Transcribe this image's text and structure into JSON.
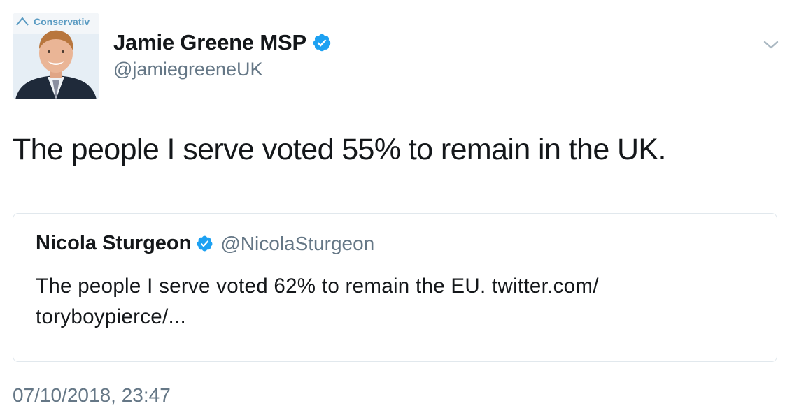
{
  "tweet": {
    "author": {
      "display_name": "Jamie Greene MSP",
      "handle": "@jamiegreeneUK",
      "verified": true,
      "avatar_backdrop_text": "Conservativ"
    },
    "text": "The people I serve voted 55% to remain in the UK.",
    "menu_icon": "chevron-down-icon",
    "quoted_tweet": {
      "display_name": "Nicola Sturgeon",
      "handle": "@NicolaSturgeon",
      "verified": true,
      "text_line1": "The people I serve voted 62% to remain the EU. twitter.com/",
      "text_line2": "toryboypierce/..."
    },
    "timestamp": "07/10/2018, 23:47"
  },
  "colors": {
    "text_primary": "#14171a",
    "text_secondary": "#657786",
    "verified_blue": "#1da1f2",
    "card_border": "#e1e8ed"
  }
}
